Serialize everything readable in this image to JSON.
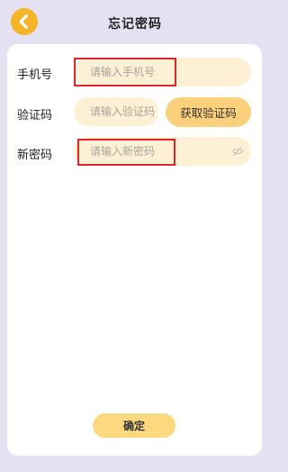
{
  "header": {
    "title": "忘记密码",
    "back_icon": "chevron-left-icon"
  },
  "form": {
    "phone": {
      "label": "手机号",
      "placeholder": "请输入手机号",
      "value": ""
    },
    "code": {
      "label": "验证码",
      "placeholder": "请输入验证码",
      "value": "",
      "get_code_label": "获取验证码"
    },
    "password": {
      "label": "新密码",
      "placeholder": "请输入新密码",
      "value": "",
      "toggle_icon": "eye-off-icon"
    },
    "confirm_label": "确定"
  },
  "colors": {
    "background": "#e3e1f2",
    "accent": "#f6b427",
    "field_fill": "#fdf0d5",
    "button_fill": "#fbd07c",
    "highlight": "#e2242b"
  }
}
